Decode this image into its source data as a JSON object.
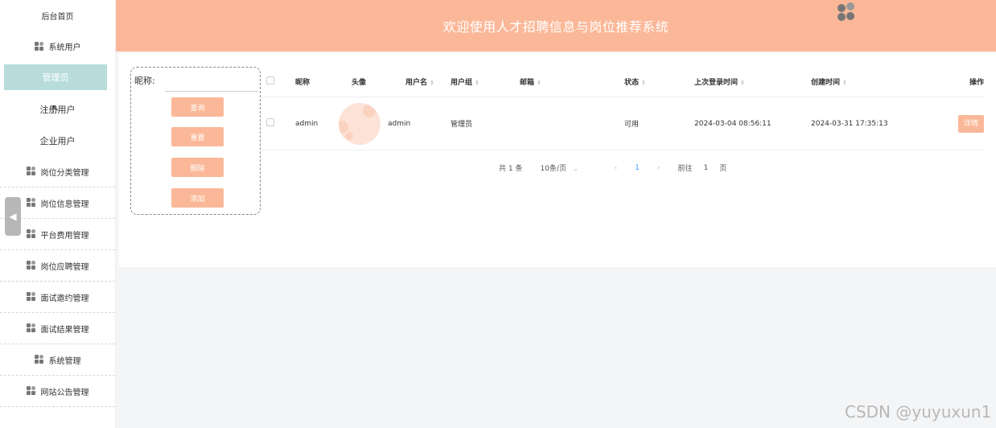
{
  "sidebar": {
    "home": "后台首页",
    "system_users": "系统用户",
    "sub_items": [
      "管理员",
      "注册用户",
      "企业用户"
    ],
    "items": [
      "岗位分类管理",
      "岗位信息管理",
      "平台费用管理",
      "岗位应聘管理",
      "面试邀约管理",
      "面试结果管理",
      "系统管理",
      "网站公告管理"
    ]
  },
  "header": {
    "title": "欢迎使用人才招聘信息与岗位推荐系统"
  },
  "search": {
    "label": "昵称:",
    "value": "",
    "buttons": [
      "查询",
      "重置",
      "删除",
      "添加"
    ]
  },
  "table": {
    "headers": [
      "昵称",
      "头像",
      "用户名",
      "用户组",
      "邮箱",
      "状态",
      "上次登录时间",
      "创建时间",
      "操作"
    ],
    "rows": [
      {
        "nickname": "admin",
        "username": "admin",
        "group": "管理员",
        "email": "",
        "status": "可用",
        "last_login": "2024-03-04 08:56:11",
        "created": "2024-03-31 17:35:13",
        "action": "详情"
      }
    ]
  },
  "pagination": {
    "total": "共 1 条",
    "page_size": "10条/页",
    "current": "1",
    "goto": "前往",
    "goto_value": "1",
    "page_unit": "页"
  },
  "watermark": "CSDN @yuyuxun1",
  "colors": {
    "accent": "#fbb898",
    "active_menu": "#b8dcdc",
    "link": "#409eff"
  }
}
